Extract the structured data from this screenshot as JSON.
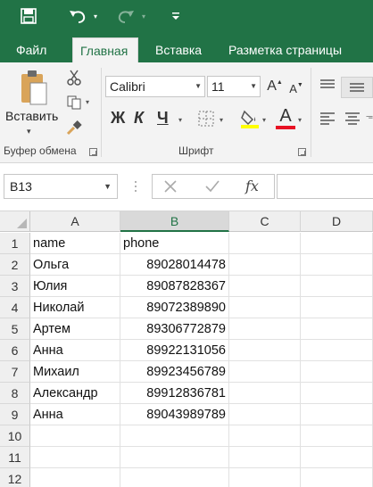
{
  "quick_access": {
    "save_icon": "save-icon",
    "undo_icon": "undo-icon",
    "redo_icon": "redo-icon",
    "customize_icon": "customize-qat-icon"
  },
  "tabs": [
    {
      "label": "Файл",
      "active": false
    },
    {
      "label": "Главная",
      "active": true
    },
    {
      "label": "Вставка",
      "active": false
    },
    {
      "label": "Разметка страницы",
      "active": false
    }
  ],
  "ribbon": {
    "clipboard": {
      "paste_label": "Вставить",
      "group_label": "Буфер обмена"
    },
    "font": {
      "font_name": "Calibri",
      "font_size": "11",
      "bold": "Ж",
      "italic": "К",
      "underline": "Ч",
      "grow_font": "A",
      "shrink_font": "A",
      "font_color_letter": "A",
      "group_label": "Шрифт",
      "highlight_color": "#ffff00",
      "font_color": "#e81123"
    }
  },
  "formula_bar": {
    "name_box": "B13",
    "cancel_icon": "cancel-icon",
    "enter_icon": "enter-icon",
    "fx_label": "fx",
    "formula": ""
  },
  "grid": {
    "selected_cell": "B13",
    "columns": [
      "A",
      "B",
      "C",
      "D"
    ],
    "row_numbers": [
      "1",
      "2",
      "3",
      "4",
      "5",
      "6",
      "7",
      "8",
      "9",
      "10",
      "11",
      "12"
    ],
    "rows": [
      {
        "a": "name",
        "b": "phone"
      },
      {
        "a": "Ольга",
        "b": "89028014478"
      },
      {
        "a": "Юлия",
        "b": "89087828367"
      },
      {
        "a": "Николай",
        "b": "89072389890"
      },
      {
        "a": "Артем",
        "b": "89306772879"
      },
      {
        "a": "Анна",
        "b": "89922131056"
      },
      {
        "a": "Михаил",
        "b": "89923456789"
      },
      {
        "a": "Александр",
        "b": "89912836781"
      },
      {
        "a": "Анна",
        "b": "89043989789"
      },
      {
        "a": "",
        "b": ""
      },
      {
        "a": "",
        "b": ""
      },
      {
        "a": "",
        "b": ""
      }
    ]
  },
  "colors": {
    "brand": "#217346",
    "ribbon_bg": "#f3f3f3",
    "header_bg": "#efefef"
  }
}
